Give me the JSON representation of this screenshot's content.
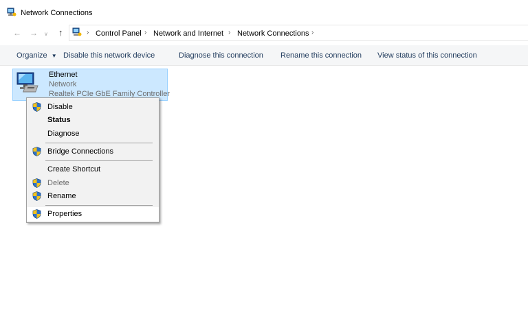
{
  "window": {
    "title": "Network Connections",
    "icon": "network-connections-icon"
  },
  "nav": {
    "back_icon": "back-arrow-icon",
    "forward_icon": "forward-arrow-icon",
    "recent_icon": "chevron-down-icon",
    "up_icon": "up-arrow-icon",
    "breadcrumb": [
      "Control Panel",
      "Network and Internet",
      "Network Connections"
    ]
  },
  "commands": [
    "Organize",
    "Disable this network device",
    "Diagnose this connection",
    "Rename this connection",
    "View status of this connection"
  ],
  "item": {
    "name": "Ethernet",
    "type": "Network",
    "adapter": "Realtek PCIe GbE Family Controller"
  },
  "context_menu": {
    "items": [
      {
        "label": "Disable",
        "shield": true,
        "bold": false,
        "disabled": false
      },
      {
        "label": "Status",
        "shield": false,
        "bold": true,
        "disabled": false
      },
      {
        "label": "Diagnose",
        "shield": false,
        "bold": false,
        "disabled": false
      },
      {
        "label": "Bridge Connections",
        "shield": true,
        "bold": false,
        "disabled": false
      },
      {
        "label": "Create Shortcut",
        "shield": false,
        "bold": false,
        "disabled": false
      },
      {
        "label": "Delete",
        "shield": true,
        "bold": false,
        "disabled": true
      },
      {
        "label": "Rename",
        "shield": true,
        "bold": false,
        "disabled": false
      },
      {
        "label": "Properties",
        "shield": true,
        "bold": false,
        "disabled": false,
        "highlighted": true
      }
    ]
  },
  "colors": {
    "selection_bg": "#cce8ff",
    "selection_border": "#99d1ff",
    "command_text": "#1e395b",
    "command_bar_bg": "#f5f6f7"
  }
}
